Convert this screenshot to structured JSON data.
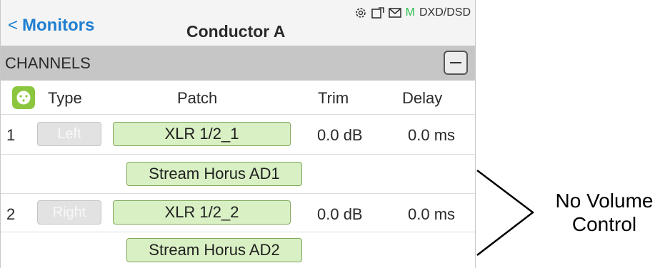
{
  "header": {
    "back_label": "Monitors",
    "back_chevron": "<",
    "title": "Conductor A",
    "status_m": "M",
    "status_mode": "DXD/DSD"
  },
  "icons": {
    "status": [
      "gear-icon",
      "card-icon",
      "mail-icon"
    ],
    "xlr": "xlr-connector-icon",
    "collapse": "minus-icon"
  },
  "section": {
    "label": "CHANNELS"
  },
  "columns": {
    "type": "Type",
    "patch": "Patch",
    "trim": "Trim",
    "delay": "Delay"
  },
  "channels": [
    {
      "num": "1",
      "type": "Left",
      "patch": "XLR 1/2_1",
      "trim": "0.0 dB",
      "delay": "0.0 ms",
      "stream": "Stream Horus AD1"
    },
    {
      "num": "2",
      "type": "Right",
      "patch": "XLR 1/2_2",
      "trim": "0.0 dB",
      "delay": "0.0 ms",
      "stream": "Stream Horus AD2"
    }
  ],
  "annotation": {
    "line1": "No Volume",
    "line2": "Control"
  },
  "colors": {
    "accent": "#1f7fd0",
    "patch_fill": "#d9f0c4",
    "xlr_green": "#8cc63f",
    "section_bg": "#c6c6c6",
    "m_green": "#2fbf4f"
  }
}
